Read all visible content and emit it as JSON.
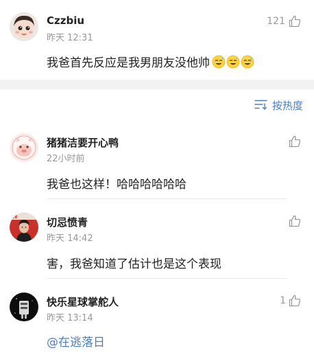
{
  "top_comment": {
    "user": "Czzbiu",
    "time": "昨天 12:31",
    "likes": "121",
    "text": "我爸首先反应是我男朋友没他帅",
    "emoji_count": 3,
    "emoji_icon": "smiling-sweat-face-icon"
  },
  "sort": {
    "icon": "sort-lines-icon",
    "label": "按热度"
  },
  "replies": [
    {
      "user": "猪猪洁要开心鸭",
      "time": "22小时前",
      "likes": "",
      "text": "我爸也这样！哈哈哈哈哈哈"
    },
    {
      "user": "切忌愤青",
      "time": "昨天 14:42",
      "likes": "",
      "text": "害，我爸知道了估计也是这个表现"
    },
    {
      "user": "快乐星球掌舵人",
      "time": "昨天 13:14",
      "likes": "1",
      "text": "@在逃落日"
    }
  ],
  "colors": {
    "link": "#4a7fbf",
    "muted": "#999999",
    "separator": "#f2f2f2"
  }
}
